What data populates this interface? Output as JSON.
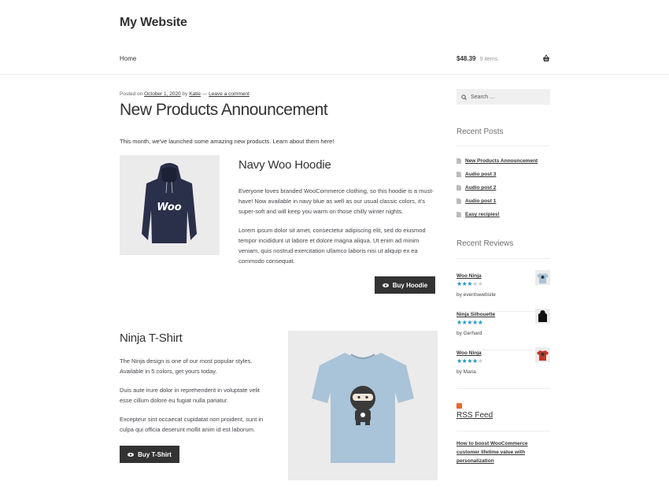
{
  "header": {
    "site_title": "My Website",
    "nav_home": "Home",
    "cart_total": "$48.39",
    "cart_count": "9 items"
  },
  "post": {
    "posted_on_prefix": "Posted on",
    "date": "October 1, 2020",
    "by": "by",
    "author": "Katie",
    "separator": "—",
    "comment_link": "Leave a comment",
    "title": "New Products Announcement",
    "intro": "This month, we've launched some amazing new products. Learn about them here!"
  },
  "hoodie": {
    "title": "Navy Woo Hoodie",
    "para1": "Everyone loves branded WooCommerce clothing, so this hoodie is a must-have! Now available in navy blue as well as our usual classic colors, it's super-soft and will keep you warm on those chilly winter nights.",
    "para2": "Lorem ipsum dolor sit amet, consectetur adipiscing elit, sed do eiusmod tempor incididunt ut labore et dolore magna aliqua. Ut enim ad minim veniam, quis nostrud exercitation ullamco laboris nisi ut aliquip ex ea commodo consequat.",
    "button": "Buy Hoodie",
    "logo_text": "Woo"
  },
  "tshirt": {
    "title": "Ninja T-Shirt",
    "para1": "The Ninja design is one of our most popular styles. Available in 5 colors, get yours today.",
    "para2": "Duis aute irure dolor in reprehenderit in voluptate velit esse cillum dolore eu fugiat nulla pariatur.",
    "para3": "Excepteur sint occaecat cupidatat non proident, sunt in culpa qui officia deserunt mollit anim id est laborum.",
    "button": "Buy T-Shirt"
  },
  "sidebar": {
    "search_placeholder": "Search …",
    "recent_posts_heading": "Recent Posts",
    "recent_posts": [
      "New Products Announcement",
      "Audio post 3",
      "Audio post 2",
      "Audio post 1",
      "Easy recipies!"
    ],
    "recent_reviews_heading": "Recent Reviews",
    "reviews": [
      {
        "product": "Woo Ninja",
        "rating": 3,
        "by": "by eventswebsite"
      },
      {
        "product": "Ninja Silhouette",
        "rating": 5,
        "by": "by Gerhard"
      },
      {
        "product": "Woo Ninja",
        "rating": 4,
        "by": "by Maria"
      }
    ],
    "rss_title": "RSS Feed",
    "rss_item": "How to boost WooCommerce customer lifetime value with personalization"
  },
  "colors": {
    "button_bg": "#333333",
    "star_color": "#2296b7",
    "rss_color": "#f26522",
    "hoodie_navy": "#2a2f4a",
    "tshirt_blue": "#a9c3d8"
  }
}
